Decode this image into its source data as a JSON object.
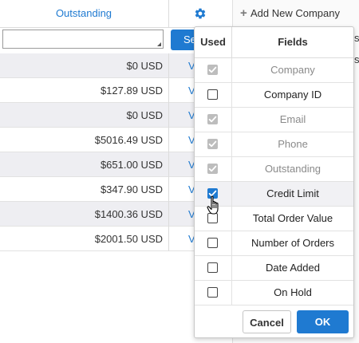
{
  "grid": {
    "column_title": "Outstanding",
    "search_label": "Se",
    "filter_value": "",
    "rows": [
      {
        "amount": "$0 USD",
        "link": "V"
      },
      {
        "amount": "$127.89 USD",
        "link": "V"
      },
      {
        "amount": "$0 USD",
        "link": "V"
      },
      {
        "amount": "$5016.49 USD",
        "link": "V"
      },
      {
        "amount": "$651.00 USD",
        "link": "V"
      },
      {
        "amount": "$347.90 USD",
        "link": "V"
      },
      {
        "amount": "$1400.36 USD",
        "link": "V"
      },
      {
        "amount": "$2001.50 USD",
        "link": "V"
      }
    ]
  },
  "side": {
    "add_company": "Add New Company",
    "frag1": "s",
    "frag2": "s"
  },
  "popup": {
    "header_used": "Used",
    "header_fields": "Fields",
    "fields": [
      {
        "name": "Company",
        "state": "disabled"
      },
      {
        "name": "Company ID",
        "state": "unchecked"
      },
      {
        "name": "Email",
        "state": "disabled"
      },
      {
        "name": "Phone",
        "state": "disabled"
      },
      {
        "name": "Outstanding",
        "state": "disabled"
      },
      {
        "name": "Credit Limit",
        "state": "checked"
      },
      {
        "name": "Total Order Value",
        "state": "unchecked"
      },
      {
        "name": "Number of Orders",
        "state": "unchecked"
      },
      {
        "name": "Date Added",
        "state": "unchecked"
      },
      {
        "name": "On Hold",
        "state": "unchecked"
      }
    ],
    "cancel_label": "Cancel",
    "ok_label": "OK"
  },
  "colors": {
    "accent": "#1f7ad1",
    "disabled_checkbox": "#bdbdbd",
    "row_alt": "#eeeef2"
  }
}
